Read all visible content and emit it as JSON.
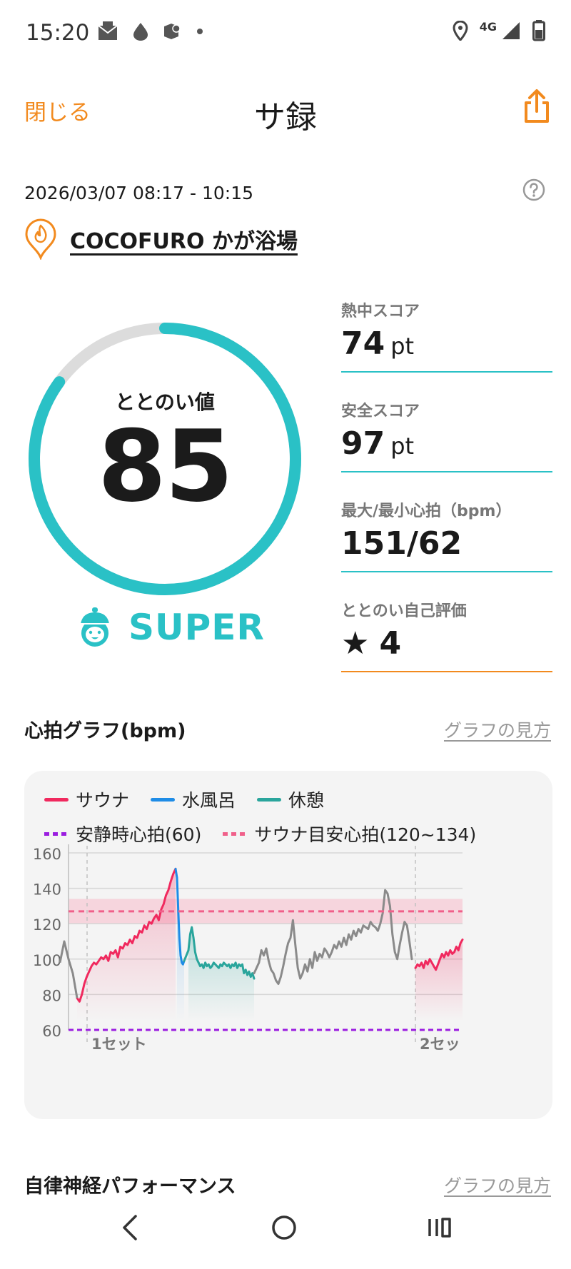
{
  "status_bar": {
    "time": "15:20",
    "network": "4G",
    "left_icons": [
      "mail-icon",
      "drop-icon",
      "app-icon",
      "dot-icon"
    ],
    "right_icons": [
      "location-icon",
      "signal-icon",
      "battery-icon"
    ]
  },
  "header": {
    "close_label": "閉じる",
    "title": "サ録",
    "share_icon": "share-icon",
    "accent_color": "#f28a1e"
  },
  "session": {
    "datetime": "2026/03/07 08:17 - 10:15",
    "facility_name": "COCOFURO かが浴場"
  },
  "totonoi": {
    "label": "ととのい値",
    "value": "85",
    "score": 85,
    "max_score": 100,
    "rank": "SUPER",
    "color": "#2ac1c6"
  },
  "metrics": [
    {
      "label": "熱中スコア",
      "value": "74",
      "unit": "pt"
    },
    {
      "label": "安全スコア",
      "value": "97",
      "unit": "pt"
    },
    {
      "label": "最大/最小心拍（bpm）",
      "value": "151/62",
      "unit": ""
    },
    {
      "label": "ととのい自己評価",
      "value": "4",
      "unit": "",
      "star": "★"
    }
  ],
  "heart_section": {
    "title": "心拍グラフ(bpm)",
    "link": "グラフの見方"
  },
  "legend": {
    "sauna": "サウナ",
    "water": "水風呂",
    "rest": "休憩",
    "resting_hr": "安静時心拍(60)",
    "sauna_target": "サウナ目安心拍(120~134)"
  },
  "colors": {
    "sauna": "#f0295e",
    "water": "#1e8ce6",
    "rest": "#2aa59c",
    "other": "#8a8a8a",
    "resting": "#9b1de0",
    "target": "#f0608a"
  },
  "chart_data": {
    "type": "line",
    "title": "",
    "xlabel": "",
    "ylabel": "",
    "ylim": [
      60,
      160
    ],
    "yticks": [
      160,
      140,
      120,
      100,
      80,
      60
    ],
    "grid": true,
    "legend_position": "top",
    "set_labels": [
      "1セット",
      "2セッ"
    ],
    "resting_hr": 60,
    "target_band": [
      120,
      134
    ],
    "target_line": 127,
    "series": [
      {
        "name": "サウナ",
        "segment": "sauna",
        "y": [
          78,
          76,
          80,
          86,
          90,
          93,
          96,
          98,
          97,
          99,
          101,
          100,
          102,
          99,
          104,
          103,
          105,
          101,
          107,
          106,
          109,
          108,
          111,
          109,
          113,
          112,
          116,
          115,
          119,
          117,
          121,
          120,
          123,
          125,
          122,
          128,
          131,
          136,
          139,
          144,
          148,
          151
        ]
      },
      {
        "name": "水風呂",
        "segment": "water",
        "y": [
          146,
          128,
          112,
          102,
          98,
          97,
          99
        ]
      },
      {
        "name": "休憩",
        "segment": "rest",
        "y": [
          105,
          114,
          118,
          112,
          104,
          100,
          98,
          96,
          97,
          95,
          98,
          96,
          97,
          95,
          96,
          98,
          97,
          96,
          95,
          97,
          96,
          98,
          97,
          96,
          97,
          95,
          97,
          96,
          98,
          95,
          97,
          96,
          97,
          92,
          94,
          91,
          93,
          90,
          92,
          89
        ]
      },
      {
        "name": "",
        "segment": "other",
        "y": [
          92,
          95,
          98,
          105,
          102,
          106,
          99,
          94,
          92,
          88,
          86,
          90,
          96,
          103,
          109,
          112,
          122,
          108,
          95,
          89,
          92,
          97,
          93,
          100,
          95,
          104,
          99,
          103,
          101,
          106,
          104,
          101,
          104,
          108,
          106,
          110,
          107,
          112,
          108,
          114,
          111,
          116,
          113,
          117,
          115,
          119,
          118,
          117,
          121,
          119,
          118,
          116,
          120,
          126,
          139,
          137,
          130,
          114,
          104,
          100,
          108,
          115,
          121,
          119,
          110,
          100
        ]
      },
      {
        "name": "サウナ",
        "segment": "sauna",
        "y": [
          95,
          97,
          96,
          98,
          95,
          99,
          97,
          100,
          98,
          96,
          94,
          97,
          100,
          103,
          101,
          104,
          102,
          105,
          103,
          104,
          107,
          105,
          109,
          111
        ]
      }
    ]
  },
  "autonomic_section": {
    "title": "自律神経パフォーマンス",
    "link": "グラフの見方"
  },
  "nav": {
    "icons": [
      "back-icon",
      "home-icon",
      "recents-icon"
    ]
  }
}
